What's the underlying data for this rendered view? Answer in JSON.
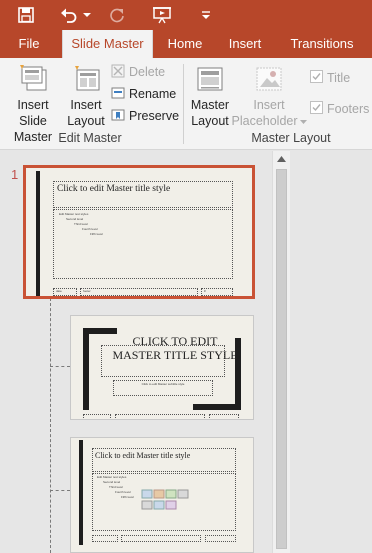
{
  "quick_access": {
    "save_icon": "save-icon",
    "undo_icon": "undo-icon",
    "undo_dropdown_icon": "chevron-down-icon",
    "redo_icon": "redo-icon",
    "start_presentation_icon": "slideshow-icon",
    "customize_icon": "customize-qat-icon"
  },
  "tabs": [
    {
      "label": "File"
    },
    {
      "label": "Slide Master",
      "active": true
    },
    {
      "label": "Home"
    },
    {
      "label": "Insert"
    },
    {
      "label": "Transitions"
    }
  ],
  "ribbon": {
    "edit_master": {
      "group_label": "Edit Master",
      "insert_slide_master": [
        "Insert Slide",
        "Master"
      ],
      "insert_layout": [
        "Insert",
        "Layout"
      ],
      "delete": "Delete",
      "rename": "Rename",
      "preserve": "Preserve"
    },
    "master_layout": {
      "group_label": "Master Layout",
      "master_layout": [
        "Master",
        "Layout"
      ],
      "insert_placeholder": [
        "Insert",
        "Placeholder"
      ],
      "title_checkbox": "Title",
      "footers_checkbox": "Footers"
    }
  },
  "thumbnails": {
    "selected_number": "1",
    "slides": [
      {
        "title": "Click to edit Master title style",
        "bullets": [
          "Edit Master text styles",
          "Second level",
          "Third level",
          "Fourth level",
          "Fifth level"
        ],
        "footer": [
          "date",
          "footer",
          "#"
        ]
      },
      {
        "title": "CLICK TO EDIT MASTER TITLE STYLE",
        "subtitle": "Click to edit Master subtitle style"
      },
      {
        "title": "Click to edit Master title style",
        "bullets": [
          "Edit Master text styles",
          "Second level",
          "Third level",
          "Fourth level",
          "Fifth level"
        ]
      }
    ]
  },
  "colors": {
    "accent": "#b7472a",
    "selection": "#c95235",
    "slide_bg": "#f1efe8",
    "slide_bar": "#1e1e1e"
  }
}
